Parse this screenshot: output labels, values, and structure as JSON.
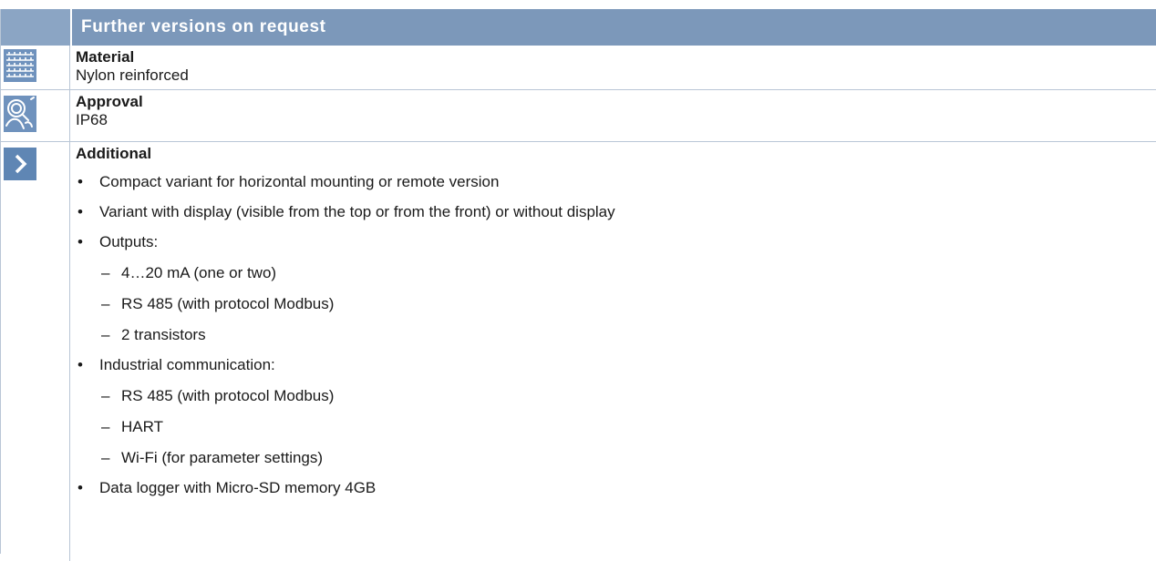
{
  "header": {
    "title": "Further versions on request"
  },
  "material": {
    "icon": "fabric-weave-icon",
    "heading": "Material",
    "value": "Nylon reinforced"
  },
  "approval": {
    "icon": "inspector-magnifier-icon",
    "heading": "Approval",
    "value": "IP68"
  },
  "additional": {
    "icon": "chevron-right-icon",
    "heading": "Additional",
    "items": [
      {
        "text": "Compact variant for horizontal mounting or remote version",
        "sub": []
      },
      {
        "text": "Variant with display (visible from the top or from the front) or without display",
        "sub": []
      },
      {
        "text": "Outputs:",
        "sub": [
          "4…20 mA (one or two)",
          "RS 485 (with protocol Modbus)",
          "2 transistors"
        ]
      },
      {
        "text": "Industrial communication:",
        "sub": [
          "RS 485 (with protocol Modbus)",
          "HART",
          "Wi-Fi (for parameter settings)"
        ]
      },
      {
        "text": "Data logger with Micro-SD memory 4GB",
        "sub": []
      }
    ]
  },
  "colors": {
    "header_bg": "#7c98ba",
    "icon_bg": "#5f86b4",
    "border": "#b9c6d6"
  }
}
